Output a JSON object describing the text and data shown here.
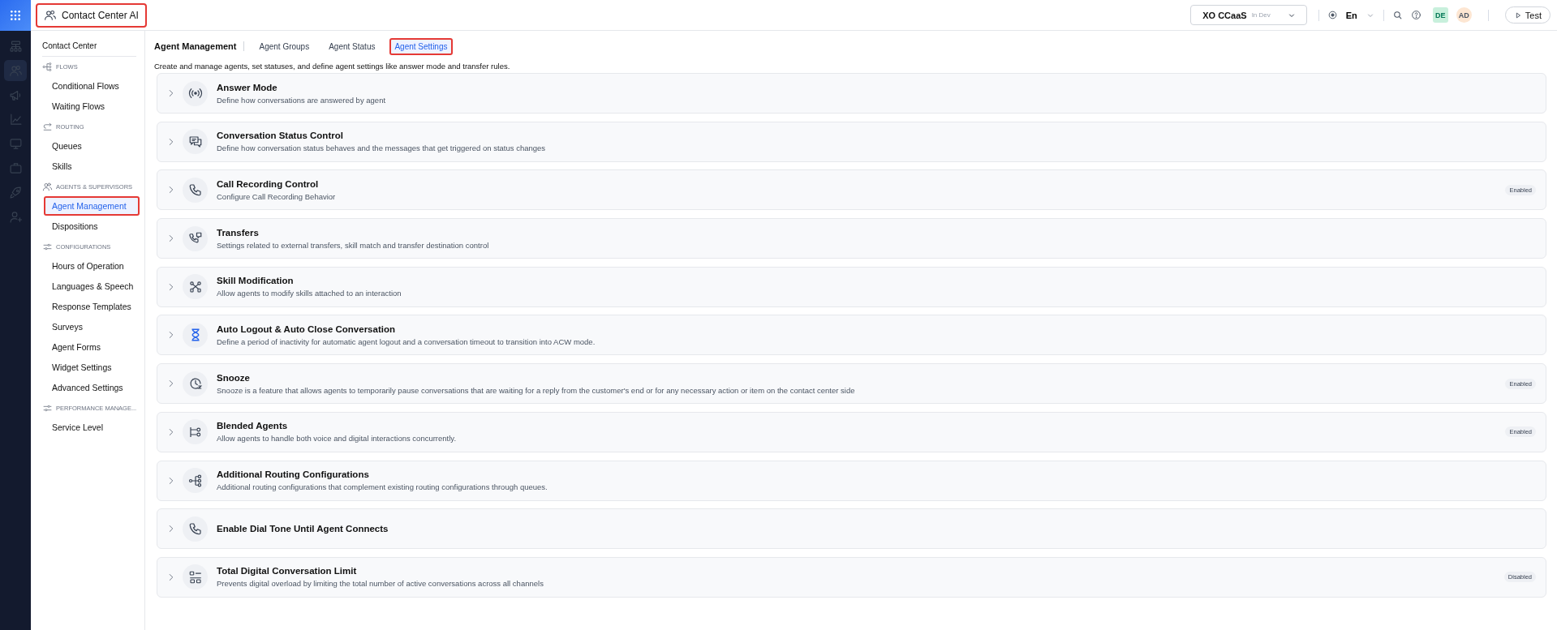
{
  "header": {
    "app_title": "Contact Center AI",
    "app_title_highlighted": true,
    "workspace": {
      "name": "XO CCaaS",
      "env": "In Dev"
    },
    "language": "En",
    "avatars": [
      {
        "initials": "DE",
        "color": "#c8f0dc"
      },
      {
        "initials": "AD",
        "color": "#fde6d2"
      }
    ],
    "test_button": "Test"
  },
  "rail": {
    "items": [
      {
        "selected": false
      },
      {
        "selected": true
      },
      {
        "selected": false
      },
      {
        "selected": false
      },
      {
        "selected": false
      },
      {
        "selected": false
      },
      {
        "selected": false
      },
      {
        "selected": false
      }
    ]
  },
  "sidebar": {
    "title": "Contact Center",
    "groups": [
      {
        "label": "FLOWS",
        "items": [
          {
            "label": "Conditional Flows",
            "selected": false,
            "highlighted": false
          },
          {
            "label": "Waiting Flows",
            "selected": false,
            "highlighted": false
          }
        ]
      },
      {
        "label": "ROUTING",
        "items": [
          {
            "label": "Queues",
            "selected": false,
            "highlighted": false
          },
          {
            "label": "Skills",
            "selected": false,
            "highlighted": false
          }
        ]
      },
      {
        "label": "AGENTS & SUPERVISORS",
        "items": [
          {
            "label": "Agent Management",
            "selected": true,
            "highlighted": true
          },
          {
            "label": "Dispositions",
            "selected": false,
            "highlighted": false
          }
        ]
      },
      {
        "label": "CONFIGURATIONS",
        "items": [
          {
            "label": "Hours of Operation",
            "selected": false,
            "highlighted": false
          },
          {
            "label": "Languages & Speech",
            "selected": false,
            "highlighted": false
          },
          {
            "label": "Response Templates",
            "selected": false,
            "highlighted": false
          },
          {
            "label": "Surveys",
            "selected": false,
            "highlighted": false
          },
          {
            "label": "Agent Forms",
            "selected": false,
            "highlighted": false
          },
          {
            "label": "Widget Settings",
            "selected": false,
            "highlighted": false
          },
          {
            "label": "Advanced Settings",
            "selected": false,
            "highlighted": false
          }
        ]
      },
      {
        "label": "PERFORMANCE MANAGE...",
        "items": [
          {
            "label": "Service Level",
            "selected": false,
            "highlighted": false
          }
        ]
      }
    ]
  },
  "page": {
    "title": "Agent Management",
    "tabs": [
      {
        "label": "Agent Groups",
        "selected": false,
        "highlighted": false
      },
      {
        "label": "Agent Status",
        "selected": false,
        "highlighted": false
      },
      {
        "label": "Agent Settings",
        "selected": true,
        "highlighted": true
      }
    ],
    "description": "Create and manage agents, set statuses, and define agent settings like answer mode and transfer rules.",
    "settings": [
      {
        "title": "Answer Mode",
        "description": "Define how conversations are answered by agent",
        "expanded": false
      },
      {
        "title": "Conversation Status Control",
        "description": "Define how conversation status behaves and the messages that get triggered on status changes",
        "expanded": false
      },
      {
        "title": "Call Recording Control",
        "description": "Configure Call Recording Behavior",
        "expanded": false,
        "status": "Enabled"
      },
      {
        "title": "Transfers",
        "description": "Settings related to external transfers, skill match and transfer destination control",
        "expanded": false
      },
      {
        "title": "Skill Modification",
        "description": "Allow agents to modify skills attached to an interaction",
        "expanded": false
      },
      {
        "title": "Auto Logout & Auto Close Conversation",
        "description": "Define a period of inactivity for automatic agent logout and a conversation timeout to transition into ACW mode.",
        "expanded": false
      },
      {
        "title": "Snooze",
        "description": "Snooze is a feature that allows agents to temporarily pause conversations that are waiting for a reply from the customer's end or for any necessary action or item on the contact center side",
        "expanded": false,
        "status": "Enabled"
      },
      {
        "title": "Blended Agents",
        "description": "Allow agents to handle both voice and digital interactions concurrently.",
        "expanded": false,
        "status": "Enabled"
      },
      {
        "title": "Additional Routing Configurations",
        "description": "Additional routing configurations that complement existing routing configurations through queues.",
        "expanded": false
      },
      {
        "title": "Enable Dial Tone Until Agent Connects",
        "expanded": false
      },
      {
        "title": "Total Digital Conversation Limit",
        "description": "Prevents digital overload by limiting the total number of active conversations across all channels",
        "expanded": false,
        "status": "Disabled"
      }
    ]
  }
}
